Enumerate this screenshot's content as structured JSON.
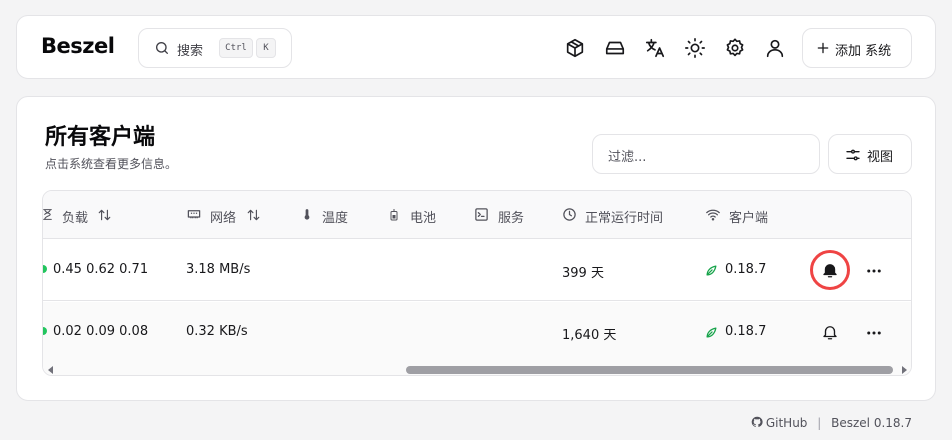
{
  "header": {
    "logo": "Beszel",
    "search": {
      "label": "搜索",
      "kbd_ctrl": "Ctrl",
      "kbd_k": "K"
    },
    "icons": [
      "box-icon",
      "hard-drive-icon",
      "languages-icon",
      "sun-icon",
      "gear-icon",
      "user-icon"
    ],
    "add_system_label": "添加 系统"
  },
  "main": {
    "title": "所有客户端",
    "subtitle": "点击系统查看更多信息。",
    "filter_placeholder": "过滤...",
    "view_label": "视图"
  },
  "table": {
    "columns": [
      {
        "key": "load",
        "label": "负载",
        "icon": "hourglass-icon",
        "sortable": true
      },
      {
        "key": "net",
        "label": "网络",
        "icon": "ethernet-icon",
        "sortable": true
      },
      {
        "key": "temp",
        "label": "温度",
        "icon": "thermometer-icon"
      },
      {
        "key": "battery",
        "label": "电池",
        "icon": "battery-icon"
      },
      {
        "key": "services",
        "label": "服务",
        "icon": "terminal-icon"
      },
      {
        "key": "uptime",
        "label": "正常运行时间",
        "icon": "clock-icon"
      },
      {
        "key": "agent",
        "label": "客户端",
        "icon": "wifi-icon"
      }
    ],
    "rows": [
      {
        "load": "0.45 0.62 0.71",
        "net": "3.18 MB/s",
        "uptime": "399 天",
        "agent": "0.18.7",
        "alert_active": true
      },
      {
        "load": "0.02 0.09 0.08",
        "net": "0.32 KB/s",
        "uptime": "1,640 天",
        "agent": "0.18.7",
        "alert_active": false
      }
    ]
  },
  "footer": {
    "github": "GitHub",
    "version": "Beszel 0.18.7"
  },
  "colors": {
    "status_up": "#22c55e",
    "agent_ok": "#16a34a",
    "highlight_ring": "#ef4444"
  }
}
